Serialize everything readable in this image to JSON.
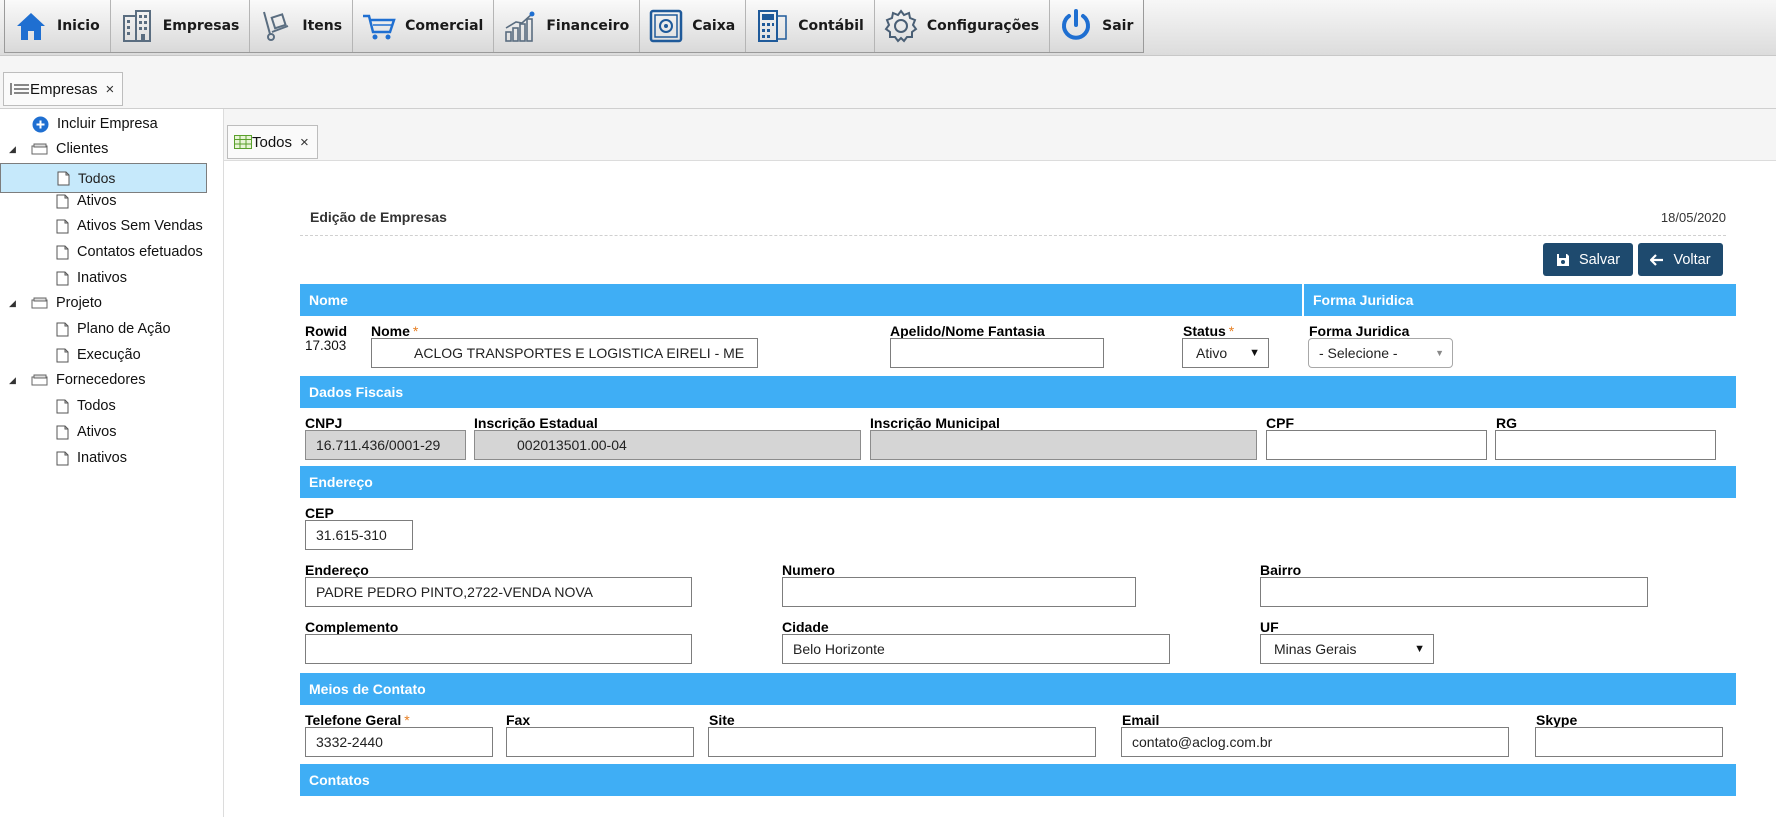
{
  "menu": {
    "items": [
      {
        "label": "Inicio",
        "icon": "home-icon"
      },
      {
        "label": "Empresas",
        "icon": "buildings-icon"
      },
      {
        "label": "Itens",
        "icon": "hand-truck-icon"
      },
      {
        "label": "Comercial",
        "icon": "shopping-cart-icon"
      },
      {
        "label": "Financeiro",
        "icon": "bar-chart-icon"
      },
      {
        "label": "Caixa",
        "icon": "safe-icon"
      },
      {
        "label": "Contábil",
        "icon": "calculator-icon"
      },
      {
        "label": "Configurações",
        "icon": "gear-icon"
      },
      {
        "label": "Sair",
        "icon": "power-icon"
      }
    ]
  },
  "outer_tab": {
    "label": "Empresas",
    "close": "×"
  },
  "inner_tab": {
    "label": "Todos",
    "close": "×"
  },
  "sidebar": {
    "add_label": "Incluir Empresa",
    "groups": [
      {
        "label": "Clientes",
        "items": [
          "Todos",
          "Ativos",
          "Ativos Sem Vendas",
          "Contatos efetuados",
          "Inativos"
        ]
      },
      {
        "label": "Projeto",
        "items": [
          "Plano de Ação",
          "Execução"
        ]
      },
      {
        "label": "Fornecedores",
        "items": [
          "Todos",
          "Ativos",
          "Inativos"
        ]
      }
    ]
  },
  "panel": {
    "title": "Edição de Empresas",
    "date": "18/05/2020",
    "save_label": "Salvar",
    "back_label": "Voltar"
  },
  "sections": {
    "nome": "Nome",
    "forma_juridica": "Forma Juridica",
    "dados_fiscais": "Dados Fiscais",
    "endereco": "Endereço",
    "meios_contato": "Meios de Contato",
    "contatos": "Contatos"
  },
  "form": {
    "rowid_label": "Rowid",
    "rowid_value": "17.303",
    "nome_label": "Nome",
    "nome_value": "ACLOG TRANSPORTES E LOGISTICA EIRELI - ME",
    "apelido_label": "Apelido/Nome Fantasia",
    "apelido_value": "",
    "status_label": "Status",
    "status_value": "Ativo",
    "forma_label": "Forma Juridica",
    "forma_value": "- Selecione -",
    "cnpj_label": "CNPJ",
    "cnpj_value": "16.711.436/0001-29",
    "ie_label": "Inscrição Estadual",
    "ie_value": "002013501.00-04",
    "im_label": "Inscrição Municipal",
    "im_value": "",
    "cpf_label": "CPF",
    "cpf_value": "",
    "rg_label": "RG",
    "rg_value": "",
    "cep_label": "CEP",
    "cep_value": "31.615-310",
    "endereco_label": "Endereço",
    "endereco_value": "PADRE PEDRO PINTO,2722-VENDA NOVA",
    "numero_label": "Numero",
    "numero_value": "",
    "bairro_label": "Bairro",
    "bairro_value": "",
    "complemento_label": "Complemento",
    "complemento_value": "",
    "cidade_label": "Cidade",
    "cidade_value": "Belo Horizonte",
    "uf_label": "UF",
    "uf_value": "Minas Gerais",
    "telefone_label": "Telefone Geral",
    "telefone_value": "3332-2440",
    "fax_label": "Fax",
    "fax_value": "",
    "site_label": "Site",
    "site_value": "",
    "email_label": "Email",
    "email_value": "contato@aclog.com.br",
    "skype_label": "Skype",
    "skype_value": "",
    "required_mark": "*"
  },
  "colors": {
    "section_blue": "#3faef5",
    "button_navy": "#1e4a6e",
    "selected_row": "#c6e9fb"
  }
}
